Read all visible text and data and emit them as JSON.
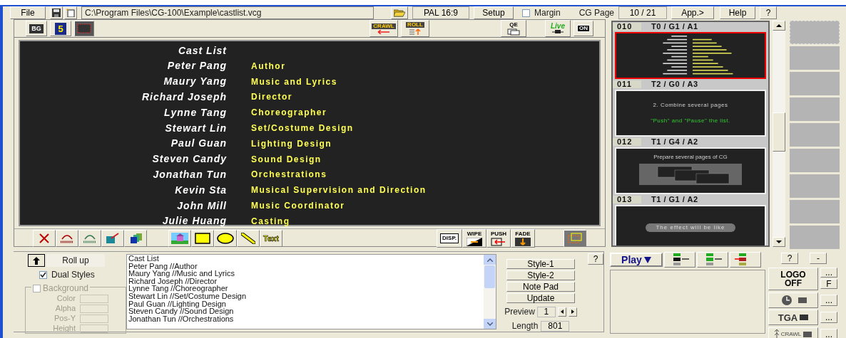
{
  "toolbar": {
    "file_menu": "File",
    "path": "C:\\Program Files\\CG-100\\Example\\castlist.vcg",
    "format": "PAL 16:9",
    "setup": "Setup",
    "margin": {
      "label": "Margin",
      "checked": false
    },
    "cg_page_label": "CG Page",
    "cg_page": "10 / 21",
    "app": "App.>",
    "help": "Help",
    "question": "?"
  },
  "editor_toolbar": {
    "bg": "BG",
    "grid": "5",
    "crawl": "CRAWL",
    "roll": "ROLL",
    "qe": "QE",
    "live": "Live",
    "on": "ON"
  },
  "preview": {
    "title": "Cast List",
    "rows": [
      {
        "name": "Peter Pang",
        "role": "Author"
      },
      {
        "name": "Maury Yang",
        "role": "Music and Lyrics"
      },
      {
        "name": "Richard Joseph",
        "role": "Director"
      },
      {
        "name": "Lynne Tang",
        "role": "Choreographer"
      },
      {
        "name": "Stewart Lin",
        "role": "Set/Costume Design"
      },
      {
        "name": "Paul Guan",
        "role": "Lighting Design"
      },
      {
        "name": "Steven Candy",
        "role": "Sound Design"
      },
      {
        "name": "Jonathan Tun",
        "role": "Orchestrations"
      },
      {
        "name": "Kevin Sta",
        "role": "Musical Supervision and Direction"
      },
      {
        "name": "John Mill",
        "role": "Music Coordinator"
      },
      {
        "name": "Julie Huang",
        "role": "Casting"
      }
    ]
  },
  "tools": {
    "text": "Text",
    "disp": "DISP.",
    "wipe": "WIPE",
    "push": "PUSH",
    "fade": "FADE"
  },
  "roll_panel": {
    "mode": "Roll up",
    "dual_styles": {
      "label": "Dual Styles",
      "checked": true
    },
    "background": {
      "label": "Background",
      "checked": false,
      "disabled": true,
      "fields": [
        "Color",
        "Alpha",
        "Pos-Y",
        "Height"
      ]
    }
  },
  "script_lines": [
    "Cast List",
    "Peter Pang //Author",
    "Maury Yang //Music and Lyrics",
    "Richard Joseph //Director",
    "Lynne Tang //Choreographer",
    "Stewart Lin //Set/Costume Design",
    "Paul Guan //Lighting Design",
    "Steven Candy //Sound Design",
    "Jonathan Tun //Orchestrations"
  ],
  "edit_buttons": {
    "help": "?",
    "style1": "Style-1",
    "style2": "Style-2",
    "notepad": "Note Pad",
    "update": "Update",
    "preview_label": "Preview",
    "preview_value": "1",
    "length_label": "Length",
    "length_value": "801"
  },
  "pages": [
    {
      "number": "010",
      "code": "T0 / G1 / A1",
      "selected": true,
      "kind": "cast"
    },
    {
      "number": "011",
      "code": "T2 / G0 / A3",
      "selected": false,
      "kind": "text",
      "lines": [
        {
          "text": "2. Combine several pages",
          "kind": "heading"
        },
        {
          "text": "\"Push\" and \"Pause\" the list.",
          "kind": "note"
        }
      ]
    },
    {
      "number": "012",
      "code": "T1 / G4 / A2",
      "selected": false,
      "kind": "stack",
      "lines": [
        {
          "text": "Prepare several pages of CG",
          "kind": "heading"
        }
      ]
    },
    {
      "number": "013",
      "code": "T1 / G1 / A2",
      "selected": false,
      "kind": "pill",
      "lines": [
        {
          "text": "The effect will be like",
          "kind": "pill"
        }
      ]
    }
  ],
  "play": "Play",
  "side": {
    "help": "?",
    "minus": "-",
    "logo": "LOGO",
    "logo_state": "OFF",
    "f": "F",
    "tga": "TGA",
    "crawl": "CRAWL",
    "more": [
      "...",
      "...",
      "...",
      "..."
    ]
  }
}
